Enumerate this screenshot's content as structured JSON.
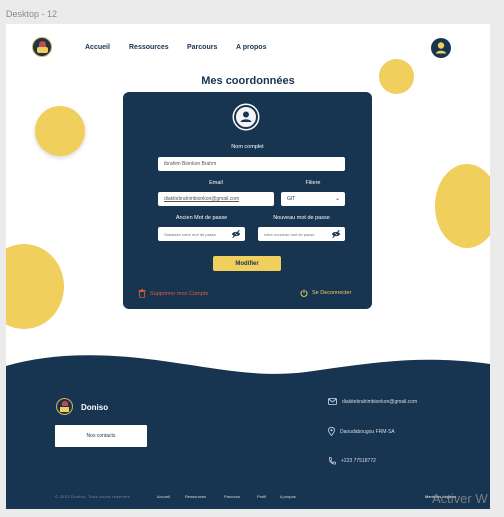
{
  "frame_label": "Desktop - 12",
  "nav": {
    "links": [
      "Accueil",
      "Ressources",
      "Parcours",
      "A propos"
    ]
  },
  "page": {
    "title": "Mes coordonnées"
  },
  "form": {
    "full_name_label": "Nom complet",
    "full_name_value": "Ibrahim Bionkon Brahm",
    "email_label": "Email",
    "email_value": "diakitebrahimbionkon@gmail.com",
    "filiere_label": "Filiere",
    "filiere_value": "GIT",
    "old_password_label": "Ancien Mot de passe",
    "old_password_placeholder": "Saisissez votre mot de passe",
    "new_password_label": "Nouveau mot de passe",
    "new_password_placeholder": "votre nouveau mot de passe",
    "save_label": "Modifier",
    "delete_label": "Supprimer mon Compte",
    "logout_label": "Se Deconnecter"
  },
  "footer": {
    "brand": "Doniso",
    "contact_button": "Nos contacts",
    "email": "diakitebrahimbionkon@gmail.com",
    "address": "Daoudabougou FRM-SA",
    "phone": "+223 77518772",
    "copyright": "© 2023 Doniso. Tous droits réservés",
    "links": [
      "Accueil",
      "Ressources",
      "Parcours",
      "Profil",
      "A propos"
    ],
    "right_text": "Mentions Légales"
  },
  "watermark": "Activer W",
  "colors": {
    "navy": "#173451",
    "yellow": "#f1cf5d",
    "danger": "#e05a3a"
  },
  "icons": [
    "user-icon",
    "eye-slash-icon",
    "chevron-down-icon",
    "trash-icon",
    "power-icon",
    "mail-icon",
    "location-icon",
    "phone-icon"
  ]
}
